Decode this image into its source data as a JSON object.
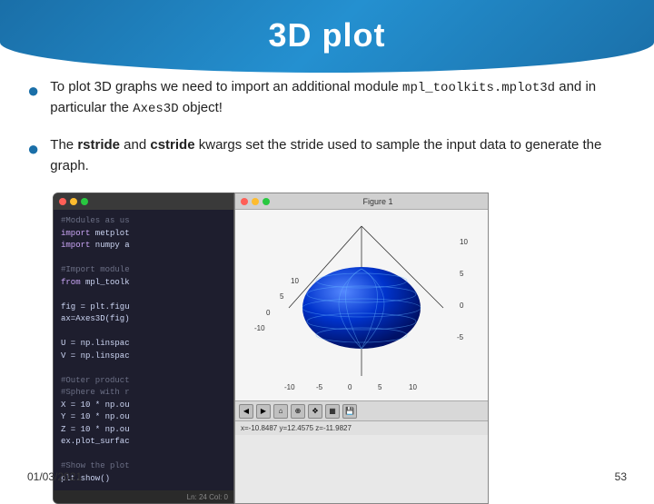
{
  "header": {
    "title": "3D plot",
    "bg_color": "#1a6fa8"
  },
  "bullets": [
    {
      "id": "bullet1",
      "text_parts": [
        {
          "type": "normal",
          "text": "To plot 3D graphs we need to import an additional module "
        },
        {
          "type": "code",
          "text": "mpl_toolkits.mplot3d"
        },
        {
          "type": "normal",
          "text": " and in particular the "
        },
        {
          "type": "code",
          "text": "Axes3D"
        },
        {
          "type": "normal",
          "text": " object!"
        }
      ]
    },
    {
      "id": "bullet2",
      "text_parts": [
        {
          "type": "normal",
          "text": "The "
        },
        {
          "type": "bold",
          "text": "rstride"
        },
        {
          "type": "normal",
          "text": " and "
        },
        {
          "type": "bold",
          "text": "cstride"
        },
        {
          "type": "normal",
          "text": " kwargs set the stride used to sample the input data to generate the graph."
        }
      ]
    }
  ],
  "ide_window": {
    "title": "",
    "lines": [
      {
        "class": "comment",
        "text": "#Modules as us"
      },
      {
        "class": "keyword",
        "text": "import metplot"
      },
      {
        "class": "keyword",
        "text": "import numpy a"
      },
      {
        "class": "normal",
        "text": ""
      },
      {
        "class": "comment",
        "text": "#Import module"
      },
      {
        "class": "keyword",
        "text": "from mpl_toolk"
      },
      {
        "class": "normal",
        "text": ""
      },
      {
        "class": "normal",
        "text": "fig = plt.figu"
      },
      {
        "class": "normal",
        "text": "ax=Axes3D(fig)"
      },
      {
        "class": "normal",
        "text": ""
      },
      {
        "class": "normal",
        "text": "U = np.linspac"
      },
      {
        "class": "normal",
        "text": "V = np.linspac"
      },
      {
        "class": "normal",
        "text": ""
      },
      {
        "class": "comment",
        "text": "#Outer product"
      },
      {
        "class": "comment",
        "text": "#Sphere with r"
      },
      {
        "class": "normal",
        "text": "X = 10 * np.ou"
      },
      {
        "class": "normal",
        "text": "Y = 10 * np.ou"
      },
      {
        "class": "normal",
        "text": "Z = 10 * np.ou"
      },
      {
        "class": "normal",
        "text": "ex.plot_surfac"
      },
      {
        "class": "normal",
        "text": ""
      },
      {
        "class": "comment",
        "text": "#Show the plot"
      },
      {
        "class": "normal",
        "text": "plt.show()"
      }
    ],
    "status": "Ln: 24 Col: 0"
  },
  "plot_window": {
    "title": "Figure 1",
    "y_axis_labels": [
      "10",
      "5",
      "0",
      "-5",
      "-10"
    ],
    "x_axis_labels": [
      "-10",
      "-5",
      "0",
      "5",
      "10"
    ],
    "z_axis_labels": [
      "10",
      "5",
      "0"
    ],
    "status_text": "x=-10.8487  y=12.4575  z=-11.9827",
    "toolbar_icons": [
      "back",
      "forward",
      "home",
      "zoom",
      "pan",
      "save",
      "settings"
    ]
  },
  "footer": {
    "date": "01/03/2021",
    "page": "53"
  }
}
